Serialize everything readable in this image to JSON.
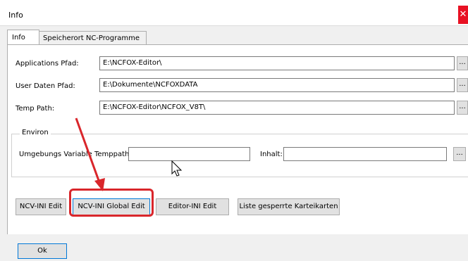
{
  "window": {
    "title": "Info",
    "close_glyph": "✕"
  },
  "tabs": [
    {
      "label": "Info",
      "active": true
    },
    {
      "label": "Speicherort NC-Programme",
      "active": false
    }
  ],
  "fields": {
    "app_path_label": "Applications Pfad:",
    "app_path_value": "E:\\NCFOX-Editor\\",
    "user_path_label": "User Daten Pfad:",
    "user_path_value": "E:\\Dokumente\\NCFOXDATA",
    "temp_path_label": "Temp Path:",
    "temp_path_value": "E:\\NCFOX-Editor\\NCFOX_V8T\\",
    "browse_label": "..."
  },
  "environ": {
    "legend": "Environ",
    "variable_label": "Umgebungs Variable Temppath:",
    "variable_value": "",
    "inhalt_label": "Inhalt:",
    "inhalt_value": ""
  },
  "buttons": {
    "ncv_ini_edit": "NCV-INI Edit",
    "ncv_ini_global_edit": "NCV-INI Global Edit",
    "editor_ini_edit": "Editor-INI Edit",
    "liste_gesperrte": "Liste gesperrte Karteikarten",
    "ok": "Ok"
  },
  "colors": {
    "accent": "#0078d7",
    "highlight": "#d9262b",
    "close": "#e81123"
  },
  "icons": [
    "close-icon",
    "cursor-icon",
    "arrow-annotation-icon"
  ]
}
